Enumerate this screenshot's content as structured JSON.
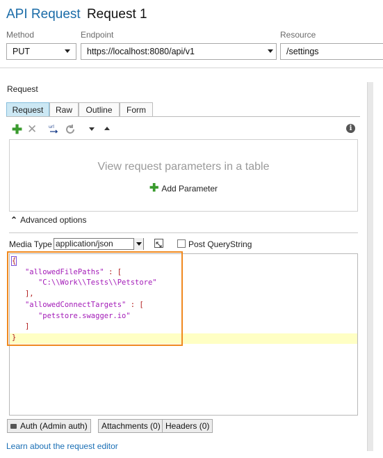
{
  "header": {
    "title_prefix": "API Request",
    "title_name": "Request 1"
  },
  "method": {
    "label": "Method",
    "value": "PUT"
  },
  "endpoint": {
    "label": "Endpoint",
    "value": "https://localhost:8080/api/v1"
  },
  "resource": {
    "label": "Resource",
    "value": "/settings"
  },
  "request": {
    "section_label": "Request",
    "tabs": [
      {
        "label": "Request"
      },
      {
        "label": "Raw"
      },
      {
        "label": "Outline"
      },
      {
        "label": "Form"
      }
    ],
    "params_hint": "View request parameters in a table",
    "add_param_label": "Add Parameter",
    "advanced_label": "Advanced options",
    "media_type_label": "Media Type",
    "media_type_value": "application/json",
    "post_querystring_label": "Post QueryString",
    "body": {
      "line1": "{",
      "key1": "\"allowedFilePaths\"",
      "colon1": " : [",
      "val1": "\"C:\\\\Work\\\\Tests\\\\Petstore\"",
      "close1": "],",
      "key2": "\"allowedConnectTargets\"",
      "colon2": " : [",
      "val2": "\"petstore.swagger.io\"",
      "close2": "]",
      "last": "}"
    }
  },
  "bottom_tabs": [
    {
      "label": "Auth (Admin auth)"
    },
    {
      "label": "Attachments (0)"
    },
    {
      "label": "Headers (0)"
    }
  ],
  "footer_link": "Learn about the request editor",
  "colors": {
    "accent": "#1b6ca8",
    "highlight_border": "#f0891f",
    "add_green": "#3a9b2e"
  }
}
